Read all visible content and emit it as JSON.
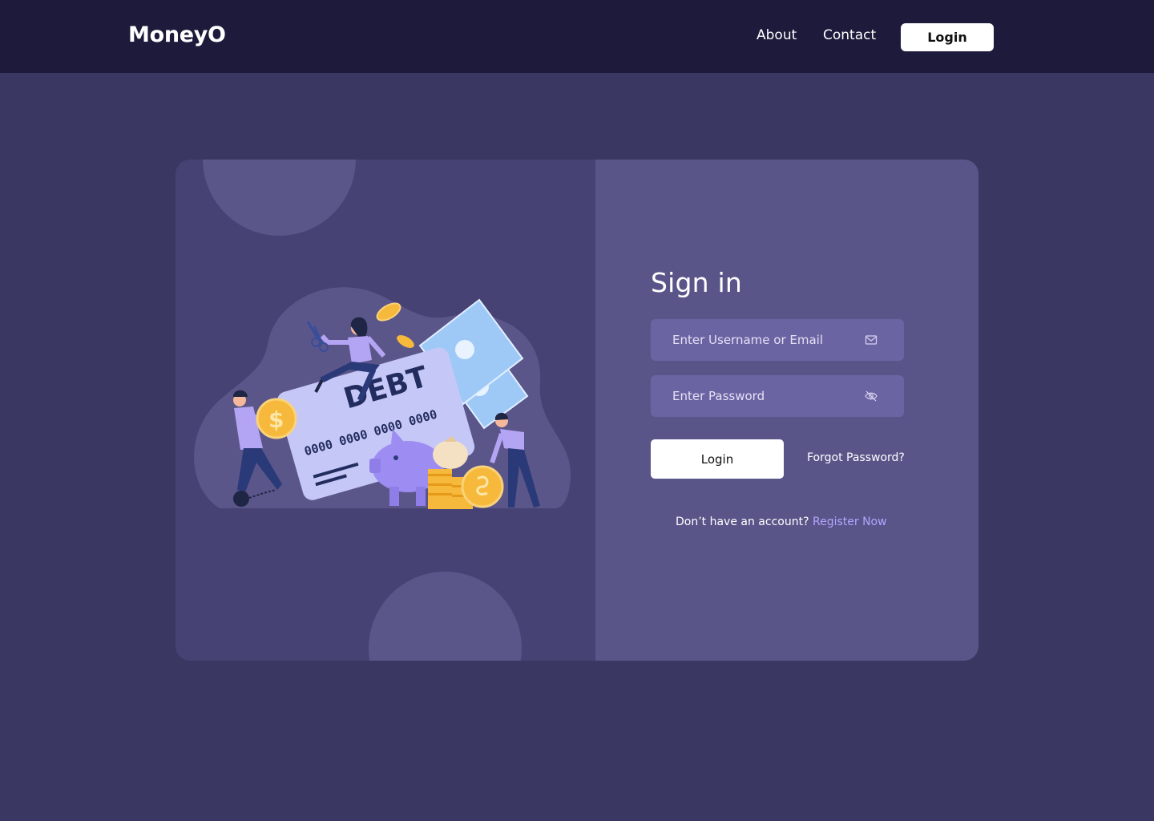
{
  "app": {
    "brand": "MoneyO"
  },
  "nav": {
    "about": "About",
    "contact": "Contact",
    "login": "Login"
  },
  "illustration": {
    "card_word": "DEBT",
    "card_number": "0000 0000 0000 0000",
    "coin_symbol": "$"
  },
  "form": {
    "title": "Sign in",
    "username_placeholder": "Enter Username or Email",
    "username_value": "",
    "username_icon": "mail-icon",
    "password_placeholder": "Enter Password",
    "password_value": "",
    "password_icon": "eye-off-icon",
    "login_button": "Login",
    "forgot_password": "Forgot Password?",
    "register_prompt": "Don’t have an account?",
    "register_link": "Register Now"
  },
  "colors": {
    "page_bg": "#3b3763",
    "navbar_bg": "#1e1a3b",
    "card_left_bg": "#464273",
    "card_right_bg": "#5a5589",
    "input_bg": "#6b64a3",
    "link_accent": "#b1a6ff"
  }
}
